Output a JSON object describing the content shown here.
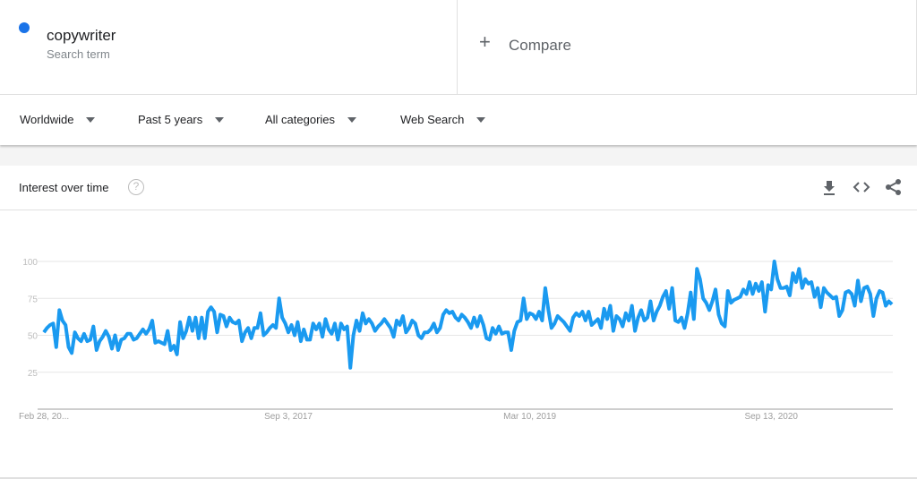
{
  "search_term": {
    "name": "copywriter",
    "subtitle": "Search term",
    "color": "#1a73e8"
  },
  "compare": {
    "icon": "plus-icon",
    "label": "Compare"
  },
  "filters": [
    {
      "label": "Worldwide"
    },
    {
      "label": "Past 5 years"
    },
    {
      "label": "All categories"
    },
    {
      "label": "Web Search"
    }
  ],
  "card": {
    "title": "Interest over time",
    "help_icon": "?",
    "actions": [
      "download-icon",
      "embed-code-icon",
      "share-icon"
    ]
  },
  "chart_data": {
    "type": "line",
    "title": "Interest over time",
    "xlabel": "",
    "ylabel": "",
    "ylim": [
      0,
      100
    ],
    "yticks": [
      25,
      50,
      75,
      100
    ],
    "xtick_labels": [
      "Feb 28, 20...",
      "Sep 3, 2017",
      "Mar 10, 2019",
      "Sep 13, 2020"
    ],
    "xtick_positions": [
      0,
      79,
      157,
      235
    ],
    "grid": true,
    "line_color": "#1a9af0",
    "series": [
      {
        "name": "copywriter",
        "values": [
          52,
          55,
          57,
          58,
          42,
          67,
          60,
          57,
          42,
          38,
          52,
          48,
          46,
          51,
          46,
          47,
          56,
          40,
          46,
          49,
          53,
          49,
          41,
          50,
          40,
          47,
          48,
          51,
          51,
          47,
          48,
          51,
          54,
          51,
          54,
          60,
          45,
          46,
          45,
          44,
          53,
          40,
          43,
          37,
          59,
          48,
          53,
          62,
          53,
          62,
          48,
          62,
          48,
          66,
          69,
          66,
          52,
          64,
          63,
          56,
          62,
          59,
          58,
          60,
          46,
          52,
          55,
          48,
          55,
          55,
          65,
          50,
          52,
          55,
          57,
          55,
          75,
          62,
          58,
          52,
          57,
          50,
          59,
          46,
          54,
          47,
          47,
          58,
          54,
          58,
          49,
          61,
          54,
          51,
          58,
          47,
          58,
          54,
          56,
          28,
          50,
          60,
          53,
          65,
          58,
          61,
          58,
          53,
          56,
          58,
          61,
          58,
          55,
          49,
          60,
          57,
          63,
          52,
          55,
          60,
          58,
          50,
          48,
          52,
          52,
          54,
          58,
          52,
          55,
          64,
          67,
          65,
          66,
          62,
          60,
          64,
          62,
          59,
          55,
          62,
          56,
          63,
          57,
          48,
          47,
          55,
          51,
          56,
          51,
          52,
          52,
          40,
          53,
          59,
          60,
          75,
          61,
          65,
          64,
          61,
          66,
          60,
          82,
          67,
          55,
          58,
          63,
          61,
          59,
          56,
          53,
          62,
          65,
          63,
          66,
          60,
          66,
          57,
          59,
          61,
          55,
          68,
          61,
          70,
          53,
          63,
          61,
          56,
          65,
          60,
          70,
          53,
          62,
          67,
          60,
          62,
          73,
          60,
          66,
          70,
          76,
          80,
          68,
          82,
          60,
          59,
          62,
          55,
          65,
          79,
          61,
          95,
          88,
          75,
          72,
          67,
          73,
          81,
          64,
          58,
          56,
          80,
          72,
          74,
          75,
          76,
          81,
          78,
          86,
          78,
          85,
          80,
          86,
          66,
          84,
          81,
          100,
          88,
          82,
          82,
          83,
          77,
          92,
          86,
          95,
          82,
          88,
          85,
          86,
          76,
          82,
          69,
          82,
          79,
          77,
          75,
          76,
          63,
          67,
          79,
          80,
          78,
          70,
          87,
          73,
          82,
          83,
          78,
          63,
          75,
          80,
          79,
          70,
          73,
          71
        ]
      }
    ]
  }
}
